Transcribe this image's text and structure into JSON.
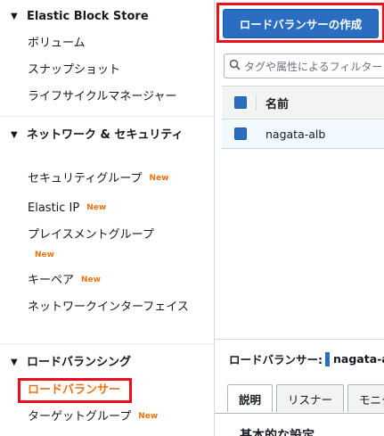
{
  "sidebar": {
    "ebs": {
      "title": "Elastic Block Store",
      "items": [
        "ボリューム",
        "スナップショット",
        "ライフサイクルマネージャー"
      ]
    },
    "network": {
      "title": "ネットワーク & セキュリティ",
      "items": [
        {
          "label": "セキュリティグループ",
          "badge": "New"
        },
        {
          "label": "Elastic IP",
          "badge": "New"
        },
        {
          "label": "プレイスメントグループ",
          "badge": "New"
        },
        {
          "label": "キーペア",
          "badge": "New"
        },
        {
          "label": "ネットワークインターフェイス",
          "badge": ""
        }
      ]
    },
    "lb": {
      "title": "ロードバランシング",
      "items": [
        {
          "label": "ロードバランサー",
          "badge": "",
          "active": true
        },
        {
          "label": "ターゲットグループ",
          "badge": "New"
        }
      ]
    }
  },
  "main": {
    "create_button": "ロードバランサーの作成",
    "search_placeholder": "タグや属性によるフィルター",
    "table": {
      "header_name": "名前",
      "rows": [
        "nagata-alb"
      ]
    },
    "details": {
      "label": "ロードバランサー:",
      "selected_name": "nagata-alb",
      "tabs": [
        "説明",
        "リスナー",
        "モニタリング"
      ],
      "section_title": "基本的な設定"
    }
  },
  "colors": {
    "accent_blue": "#2a6ec2",
    "highlight_red": "#e8101e",
    "badge_orange": "#ec7211"
  }
}
